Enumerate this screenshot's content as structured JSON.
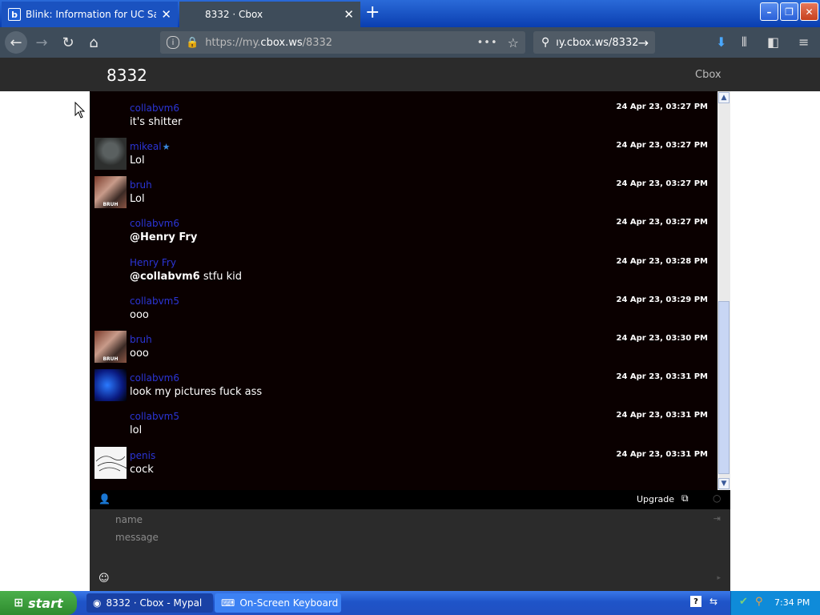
{
  "browser": {
    "tabs": [
      {
        "label": "Blink: Information for UC San Diego",
        "icon": "b",
        "close": "✕"
      },
      {
        "label": "8332 · Cbox",
        "close": "✕"
      }
    ],
    "new_tab": "+",
    "window_buttons": {
      "minimize": "–",
      "maximize": "❐",
      "close": "✕"
    },
    "nav": {
      "back": "←",
      "forward": "→",
      "reload": "↻",
      "home": "⌂"
    },
    "url_prefix": "https://my.",
    "url_domain": "cbox.ws",
    "url_path": "/8332",
    "page_actions": "•••",
    "bookmark_star": "☆",
    "search_text": "ıy.cbox.ws/8332",
    "search_go": "→",
    "toolbar_icons": {
      "download": "⬇",
      "library": "⫴",
      "sidebar": "◧",
      "menu": "≡"
    }
  },
  "cbox": {
    "title": "8332",
    "brand": "Cbox",
    "messages": [
      {
        "user": "collabvm6",
        "text": "it's shitter",
        "time": "24 Apr 23, 03:27 PM",
        "avatar": "none"
      },
      {
        "user": "mikeal",
        "star": "★",
        "text": "Lol",
        "time": "24 Apr 23, 03:27 PM",
        "avatar": "mikeal"
      },
      {
        "user": "bruh",
        "text": "Lol",
        "time": "24 Apr 23, 03:27 PM",
        "avatar": "bruh",
        "avatar_tag": "BRUH"
      },
      {
        "user": "collabvm6",
        "mention": "@Henry Fry",
        "text": "",
        "time": "24 Apr 23, 03:27 PM",
        "avatar": "none"
      },
      {
        "user": "Henry Fry",
        "mention": "@collabvm6",
        "text": " stfu kid",
        "time": "24 Apr 23, 03:28 PM",
        "avatar": "none"
      },
      {
        "user": "collabvm5",
        "text": "ooo",
        "time": "24 Apr 23, 03:29 PM",
        "avatar": "none"
      },
      {
        "user": "bruh",
        "text": "ooo",
        "time": "24 Apr 23, 03:30 PM",
        "avatar": "bruh",
        "avatar_tag": "BRUH"
      },
      {
        "user": "collabvm6",
        "text": "look my pictures fuck ass",
        "time": "24 Apr 23, 03:31 PM",
        "avatar": "blue"
      },
      {
        "user": "collabvm5",
        "text": "lol",
        "time": "24 Apr 23, 03:31 PM",
        "avatar": "none"
      },
      {
        "user": "penis",
        "text": "cock",
        "time": "24 Apr 23, 03:31 PM",
        "avatar": "penis"
      }
    ],
    "scroll": {
      "up": "▲",
      "down": "▼"
    },
    "toolbar": {
      "user_icon": "👤",
      "upgrade": "Upgrade",
      "popout_icon": "⧉",
      "refresh_icon": "○"
    },
    "form": {
      "name_placeholder": "name",
      "message_placeholder": "message",
      "login_icon": "⇥",
      "emoji_icon": "☺",
      "send_icon": "▸"
    }
  },
  "taskbar": {
    "start": "start",
    "start_flag": "⊞",
    "items": [
      {
        "label": "8332 · Cbox - Mypal",
        "icon": "◉"
      },
      {
        "label": "On-Screen Keyboard",
        "icon": "⌨"
      }
    ],
    "help": "?",
    "tray_arrow": "⇆",
    "tray_icon1": "✔",
    "tray_icon2": "⚲",
    "clock": "7:34 PM"
  }
}
